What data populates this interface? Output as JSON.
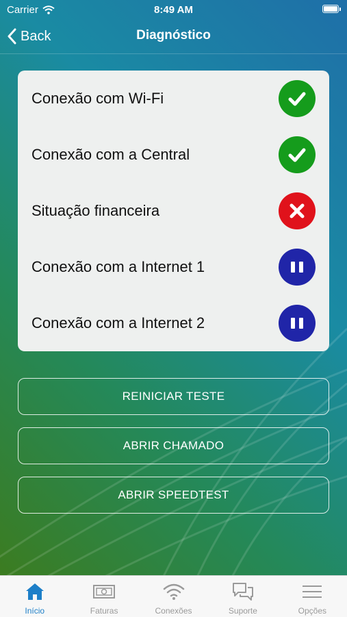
{
  "status_bar": {
    "carrier": "Carrier",
    "time": "8:49 AM"
  },
  "nav": {
    "back_label": "Back",
    "title": "Diagnóstico"
  },
  "diagnostics": [
    {
      "label": "Conexão com Wi-Fi",
      "status": "ok"
    },
    {
      "label": "Conexão com a Central",
      "status": "ok"
    },
    {
      "label": "Situação financeira",
      "status": "error"
    },
    {
      "label": "Conexão com a Internet 1",
      "status": "paused"
    },
    {
      "label": "Conexão com a Internet 2",
      "status": "paused"
    }
  ],
  "actions": {
    "restart_label": "REINICIAR TESTE",
    "ticket_label": "ABRIR CHAMADO",
    "speedtest_label": "ABRIR SPEEDTEST"
  },
  "tabs": [
    {
      "label": "Início",
      "icon": "home-icon",
      "active": true
    },
    {
      "label": "Faturas",
      "icon": "bill-icon",
      "active": false
    },
    {
      "label": "Conexões",
      "icon": "wifi-icon",
      "active": false
    },
    {
      "label": "Suporte",
      "icon": "chat-icon",
      "active": false
    },
    {
      "label": "Opções",
      "icon": "menu-icon",
      "active": false
    }
  ],
  "colors": {
    "ok": "#159c1c",
    "error": "#e0121b",
    "paused": "#2025a8",
    "tab_active": "#1d7fc8"
  }
}
